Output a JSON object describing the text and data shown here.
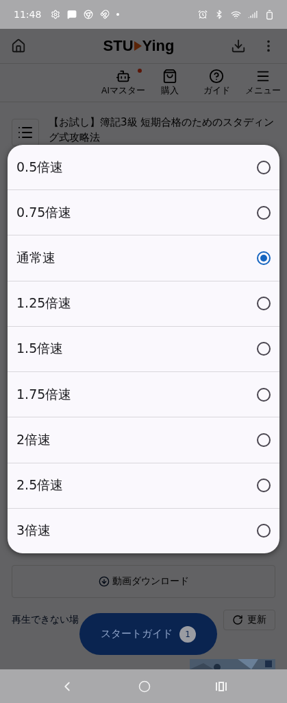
{
  "status_bar": {
    "time": "11:48"
  },
  "header": {
    "logo_left": "STU",
    "logo_right": "Ying"
  },
  "toolbar": [
    {
      "label": "AIマスター",
      "notification": true
    },
    {
      "label": "購入",
      "notification": false
    },
    {
      "label": "ガイド",
      "notification": false
    },
    {
      "label": "メニュー",
      "notification": false
    }
  ],
  "course": {
    "title": "【お試し】簿記3級 短期合格のためのスタディング式攻略法"
  },
  "speed_dialog": {
    "options": [
      {
        "label": "0.5倍速",
        "selected": false
      },
      {
        "label": "0.75倍速",
        "selected": false
      },
      {
        "label": "通常速",
        "selected": true
      },
      {
        "label": "1.25倍速",
        "selected": false
      },
      {
        "label": "1.5倍速",
        "selected": false
      },
      {
        "label": "1.75倍速",
        "selected": false
      },
      {
        "label": "2倍速",
        "selected": false
      },
      {
        "label": "2.5倍速",
        "selected": false
      },
      {
        "label": "3倍速",
        "selected": false
      }
    ]
  },
  "download_button": {
    "label": "動画ダウンロード"
  },
  "help_text": "再生できない場",
  "refresh_button": {
    "label": "更新"
  },
  "start_guide": {
    "label": "スタートガイド",
    "count": "1"
  }
}
